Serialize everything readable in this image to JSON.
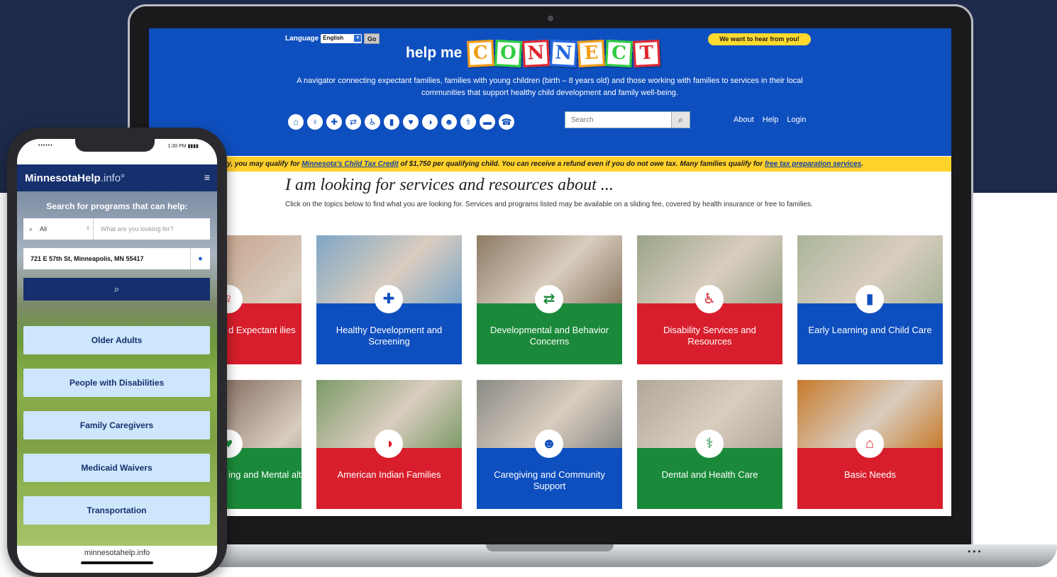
{
  "laptop": {
    "language_label": "Language",
    "language_value": "English",
    "go_label": "Go",
    "brand_prefix": "help me",
    "brand_letters": [
      {
        "char": "C",
        "color": "#f39c12"
      },
      {
        "char": "O",
        "color": "#2ecc40"
      },
      {
        "char": "N",
        "color": "#e0262e"
      },
      {
        "char": "N",
        "color": "#2266dd"
      },
      {
        "char": "E",
        "color": "#f39c12"
      },
      {
        "char": "C",
        "color": "#2ecc40"
      },
      {
        "char": "T",
        "color": "#e0262e"
      }
    ],
    "feedback_label": "We want to hear from you!",
    "tagline": "A navigator connecting expectant families, families with young children (birth – 8 years old) and those working with families to services in their local communities that support healthy child development and family well-being.",
    "nav_icons": [
      "home-icon",
      "pregnancy-icon",
      "health-icon",
      "arrows-icon",
      "accessibility-icon",
      "book-icon",
      "heart-icon",
      "medicine-wheel-icon",
      "people-icon",
      "tooth-icon",
      "bed-icon",
      "phone-icon"
    ],
    "search_placeholder": "Search",
    "links": {
      "about": "About",
      "help": "Help",
      "login": "Login"
    },
    "alert": {
      "prefix": "y, you may qualify for ",
      "link1": "Minnesota's Child Tax Credit",
      "middle": " of $1,750 per qualifying child. You can receive a refund even if you do not owe tax. Many families qualify for ",
      "link2": "free tax preparation services",
      "suffix": "."
    },
    "lead_title": "I am looking for services and resources about ...",
    "lead_desc": "Click on the topics below to find what you are looking for. Services and programs listed may be available on a sliding fee, covered by health insurance or free to families.",
    "tiles": [
      {
        "label": "d Expectant ilies",
        "icon": "pregnancy-icon",
        "glyph": "♀",
        "color": "#d81e2c",
        "photo": "#c7a590"
      },
      {
        "label": "Healthy Development and Screening",
        "icon": "health-icon",
        "glyph": "✚",
        "color": "#0e4fbf",
        "photo": "#7fa6c6"
      },
      {
        "label": "Developmental and Behavior Concerns",
        "icon": "arrows-icon",
        "glyph": "⇄",
        "color": "#1a8a3a",
        "photo": "#8d7a64"
      },
      {
        "label": "Disability Services and Resources",
        "icon": "accessibility-icon",
        "glyph": "♿",
        "color": "#d81e2c",
        "photo": "#9aa48a"
      },
      {
        "label": "Early Learning and Child Care",
        "icon": "book-icon",
        "glyph": "▮",
        "color": "#0e4fbf",
        "photo": "#a9b49a"
      },
      {
        "label": "ing and Mental alth",
        "icon": "heart-icon",
        "glyph": "♥",
        "color": "#1a8a3a",
        "photo": "#8a7466"
      },
      {
        "label": "American Indian Families",
        "icon": "medicine-wheel-icon",
        "glyph": "◑",
        "color": "#d81e2c",
        "photo": "#7d9a68"
      },
      {
        "label": "Caregiving and Community Support",
        "icon": "people-icon",
        "glyph": "☻",
        "color": "#0e4fbf",
        "photo": "#8a8a86"
      },
      {
        "label": "Dental and Health Care",
        "icon": "tooth-icon",
        "glyph": "⚕",
        "color": "#1a8a3a",
        "photo": "#b0a79a"
      },
      {
        "label": "Basic Needs",
        "icon": "bed-icon",
        "glyph": "⌂",
        "color": "#d81e2c",
        "photo": "#c77a2a"
      }
    ]
  },
  "phone": {
    "carrier": "••••••",
    "time": "1:30 PM",
    "battery": "▮▮▮▮",
    "logo_bold": "MinnesotaHelp",
    "logo_light": ".info°",
    "menu_icon": "≡",
    "search_label": "Search for programs that can help:",
    "category_value": "All",
    "query_placeholder": "What are you looking for?",
    "address_value": "721 E 57th St, Minneapolis, MN 55417",
    "categories": [
      "Older Adults",
      "People with Disabilities",
      "Family Caregivers",
      "Medicaid Waivers",
      "Transportation"
    ],
    "footer_url": "minnesotahelp.info"
  }
}
